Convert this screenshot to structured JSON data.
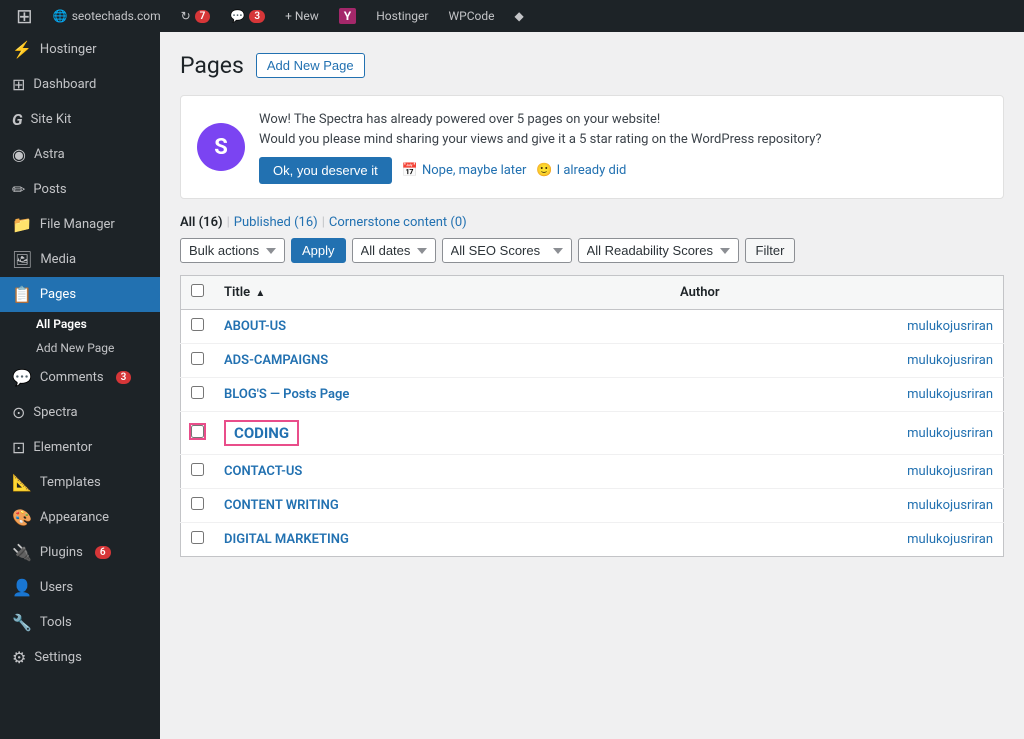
{
  "adminBar": {
    "wpLogo": "⊞",
    "site": "seotechads.com",
    "updates": "7",
    "comments": "3",
    "newLabel": "+ New",
    "yoast": "Y",
    "hostinger": "Hostinger",
    "wpcode": "WPCode",
    "diamond": "◆"
  },
  "sidebar": {
    "items": [
      {
        "id": "hostinger",
        "label": "Hostinger",
        "icon": "⚡"
      },
      {
        "id": "dashboard",
        "label": "Dashboard",
        "icon": "⊞"
      },
      {
        "id": "sitekit",
        "label": "Site Kit",
        "icon": "G"
      },
      {
        "id": "astra",
        "label": "Astra",
        "icon": "◉"
      },
      {
        "id": "posts",
        "label": "Posts",
        "icon": "📄"
      },
      {
        "id": "filemanager",
        "label": "File Manager",
        "icon": "📁"
      },
      {
        "id": "media",
        "label": "Media",
        "icon": "🖼"
      },
      {
        "id": "pages",
        "label": "Pages",
        "icon": "📋",
        "active": true
      },
      {
        "id": "comments",
        "label": "Comments",
        "icon": "💬",
        "badge": "3"
      },
      {
        "id": "spectra",
        "label": "Spectra",
        "icon": "⊙"
      },
      {
        "id": "elementor",
        "label": "Elementor",
        "icon": "⊡"
      },
      {
        "id": "templates",
        "label": "Templates",
        "icon": "📐"
      },
      {
        "id": "appearance",
        "label": "Appearance",
        "icon": "🎨"
      },
      {
        "id": "plugins",
        "label": "Plugins",
        "icon": "🔌",
        "badge": "6"
      },
      {
        "id": "users",
        "label": "Users",
        "icon": "👤"
      },
      {
        "id": "tools",
        "label": "Tools",
        "icon": "🔧"
      },
      {
        "id": "settings",
        "label": "Settings",
        "icon": "⚙"
      }
    ],
    "pagesSubItems": [
      {
        "id": "all-pages",
        "label": "All Pages",
        "active": true
      },
      {
        "id": "add-new-page",
        "label": "Add New Page"
      }
    ]
  },
  "page": {
    "title": "Pages",
    "addNewBtn": "Add New Page"
  },
  "notice": {
    "logo": "S",
    "line1": "Wow! The Spectra has already powered over 5 pages on your website!",
    "line2": "Would you please mind sharing your views and give it a 5 star rating on the WordPress repository?",
    "btnOk": "Ok, you deserve it",
    "btnLater": "Nope, maybe later",
    "btnDid": "I already did"
  },
  "filterTabs": [
    {
      "id": "all",
      "label": "All (16)",
      "active": true
    },
    {
      "id": "published",
      "label": "Published (16)"
    },
    {
      "id": "cornerstone",
      "label": "Cornerstone content (0)"
    }
  ],
  "filters": {
    "bulkActions": "Bulk actions",
    "apply": "Apply",
    "allDates": "All dates",
    "allSeoScores": "All SEO Scores",
    "allReadabilityScores": "All Readability Scores",
    "filter": "Filter"
  },
  "table": {
    "columns": [
      {
        "id": "title",
        "label": "Title",
        "sortable": true
      },
      {
        "id": "author",
        "label": "Author"
      }
    ],
    "rows": [
      {
        "id": 1,
        "title": "ABOUT-US",
        "author": "mulukojusriran",
        "highlighted": false
      },
      {
        "id": 2,
        "title": "ADS-CAMPAIGNS",
        "author": "mulukojusriran",
        "highlighted": false
      },
      {
        "id": 3,
        "title": "BLOG'S — Posts Page",
        "author": "mulukojusriran",
        "highlighted": false
      },
      {
        "id": 4,
        "title": "CODING",
        "author": "mulukojusriran",
        "highlighted": true
      },
      {
        "id": 5,
        "title": "CONTACT-US",
        "author": "mulukojusriran",
        "highlighted": false
      },
      {
        "id": 6,
        "title": "CONTENT WRITING",
        "author": "mulukojusriran",
        "highlighted": false
      },
      {
        "id": 7,
        "title": "DIGITAL MARKETING",
        "author": "mulukojusriran",
        "highlighted": false
      }
    ]
  }
}
